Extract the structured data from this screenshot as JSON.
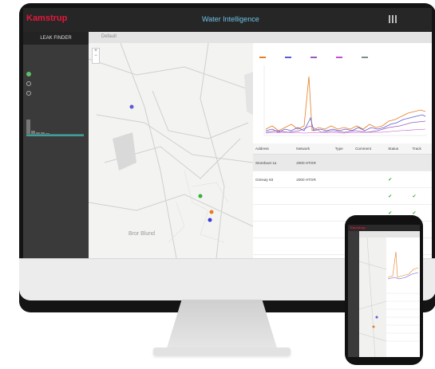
{
  "brand": {
    "logo": "Kamstrup",
    "app_title": "Water Intelligence",
    "accent": "#e6173a"
  },
  "header": {
    "user_line1": "",
    "user_line2": ""
  },
  "sidebar": {
    "heading": "LEAK FINDER",
    "section_title": "",
    "options": [
      {
        "label": "",
        "selected": true
      },
      {
        "label": "",
        "selected": false
      },
      {
        "label": "",
        "selected": false
      }
    ],
    "threshold_label": ""
  },
  "filter": {
    "label": "Default",
    "settings_label": ""
  },
  "map": {
    "place_label": "Bror Blund",
    "road_label": ""
  },
  "chart": {
    "title": "",
    "subtitle": "",
    "colors": [
      "#e67e22",
      "#5b5bd6",
      "#9b59b6",
      "#c44dce",
      "#7f8c8d"
    ]
  },
  "table": {
    "headers": [
      "Address",
      "Network",
      "Type",
      "Comment",
      "Status",
      "Track"
    ],
    "rows": [
      {
        "address": "Storebuet 1a",
        "network": "2000 HTGR",
        "type": "",
        "comment": "",
        "status": "",
        "track": "",
        "selected": true
      },
      {
        "address": "Gimsøy 83",
        "network": "2000 HTGR",
        "type": "",
        "comment": "",
        "status": "check",
        "track": ""
      },
      {
        "address": "",
        "network": "",
        "type": "",
        "comment": "",
        "status": "check",
        "track": "check"
      },
      {
        "address": "",
        "network": "",
        "type": "",
        "comment": "",
        "status": "check",
        "track": "check"
      },
      {
        "address": "",
        "network": "",
        "type": "",
        "comment": "",
        "status": "",
        "track": ""
      },
      {
        "address": "",
        "network": "",
        "type": "",
        "comment": "",
        "status": "",
        "track": ""
      },
      {
        "address": "",
        "network": "",
        "type": "",
        "comment": "",
        "status": "",
        "track": ""
      }
    ]
  },
  "phone": {
    "logo": "Kamstrup"
  }
}
